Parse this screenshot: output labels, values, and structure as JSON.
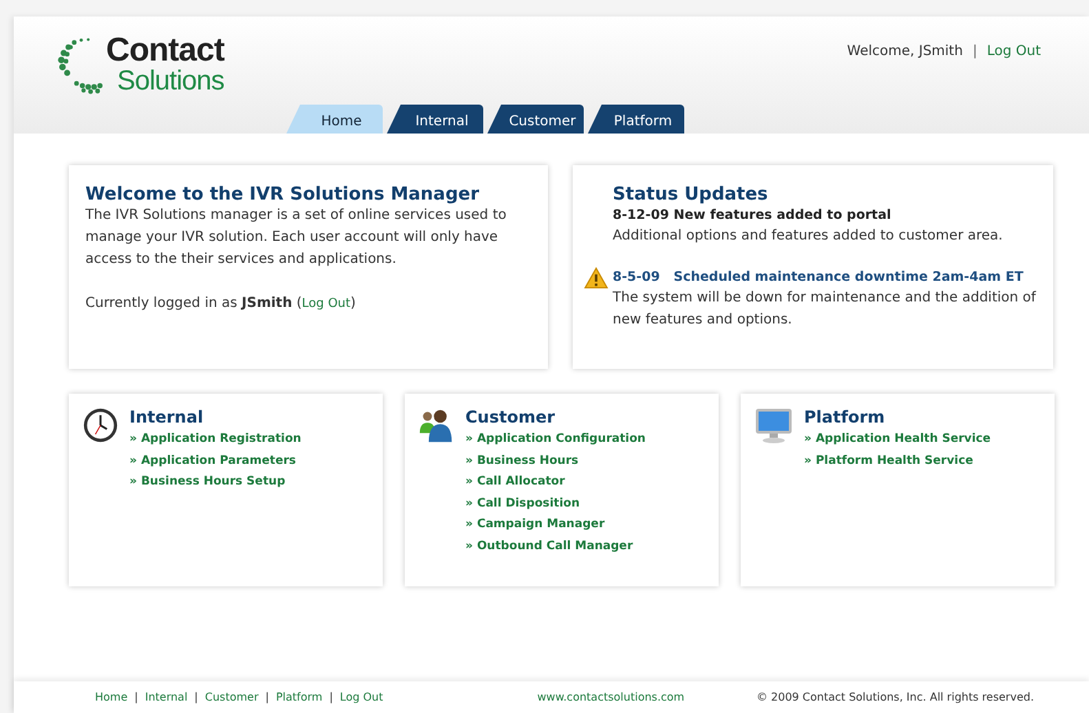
{
  "logo": {
    "line1": "Contact",
    "line2": "Solutions"
  },
  "user_bar": {
    "welcome": "Welcome, JSmith",
    "separator": "|",
    "logout": "Log Out"
  },
  "tabs": [
    {
      "label": "Home",
      "selected": true
    },
    {
      "label": "Internal",
      "selected": false
    },
    {
      "label": "Customer",
      "selected": false
    },
    {
      "label": "Platform",
      "selected": false
    }
  ],
  "welcome_card": {
    "title": "Welcome to the IVR Solutions Manager",
    "body": "The IVR Solutions manager is a set of online services used to manage your IVR solution. Each user account will only have access to the their services and applications.",
    "login": {
      "text": "Currently logged in as **JSmith** (",
      "link": "Log Out",
      "suffix": ")"
    }
  },
  "status_card": {
    "title": "Status Updates",
    "updates": [
      {
        "kind": "notice",
        "title": "8-12-09 New features added to portal",
        "body": "Additional options and features added to customer area."
      },
      {
        "kind": "alert",
        "title": "8-5-09   Scheduled maintenance downtime 2am-4am ET",
        "body": "The system will be down for maintenance and the addition of new features and options."
      }
    ]
  },
  "sections": [
    {
      "kind": "clock",
      "title": "Internal",
      "links": [
        "» Application Registration",
        "» Application Parameters",
        "» Business Hours Setup"
      ]
    },
    {
      "kind": "people",
      "title": "Customer",
      "links": [
        "» Application Configuration",
        "» Business Hours",
        "» Call Allocator",
        "» Call Disposition",
        "» Campaign Manager",
        "» Outbound Call Manager"
      ]
    },
    {
      "kind": "monitor",
      "title": "Platform",
      "links": [
        "» Application Health Service",
        "» Platform Health Service"
      ]
    }
  ],
  "footer": {
    "links": [
      "Home",
      "Internal",
      "Customer",
      "Platform",
      "Log Out"
    ],
    "separator": "|",
    "site": "www.contactsolutions.com",
    "copyright": "© 2009 Contact Solutions, Inc. All rights reserved."
  }
}
